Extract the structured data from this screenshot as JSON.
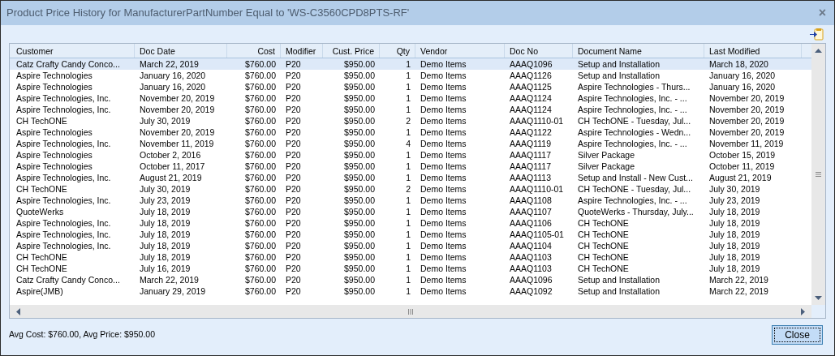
{
  "window": {
    "title": "Product Price History for ManufacturerPartNumber Equal to 'WS-C3560CPD8PTS-RF'",
    "close_label": "×"
  },
  "table": {
    "columns": [
      {
        "label": "Customer"
      },
      {
        "label": "Doc Date"
      },
      {
        "label": "Cost"
      },
      {
        "label": "Modifier"
      },
      {
        "label": "Cust. Price"
      },
      {
        "label": "Qty"
      },
      {
        "label": "Vendor"
      },
      {
        "label": "Doc No"
      },
      {
        "label": "Document Name"
      },
      {
        "label": "Last Modified"
      }
    ],
    "rows": [
      {
        "selected": true,
        "cells": [
          "Catz Crafty Candy Conco...",
          "March 22, 2019",
          "$760.00",
          "P20",
          "$950.00",
          "1",
          "Demo Items",
          "AAAQ1096",
          "Setup and Installation",
          "March 18, 2020"
        ]
      },
      {
        "selected": false,
        "cells": [
          "Aspire Technologies",
          "January 16, 2020",
          "$760.00",
          "P20",
          "$950.00",
          "1",
          "Demo Items",
          "AAAQ1126",
          "Setup and Installation",
          "January 16, 2020"
        ]
      },
      {
        "selected": false,
        "cells": [
          "Aspire Technologies",
          "January 16, 2020",
          "$760.00",
          "P20",
          "$950.00",
          "1",
          "Demo Items",
          "AAAQ1125",
          "Aspire Technologies - Thurs...",
          "January 16, 2020"
        ]
      },
      {
        "selected": false,
        "cells": [
          "Aspire Technologies, Inc.",
          "November 20, 2019",
          "$760.00",
          "P20",
          "$950.00",
          "1",
          "Demo Items",
          "AAAQ1124",
          "Aspire Technologies, Inc. - ...",
          "November 20, 2019"
        ]
      },
      {
        "selected": false,
        "cells": [
          "Aspire Technologies, Inc.",
          "November 20, 2019",
          "$760.00",
          "P20",
          "$950.00",
          "1",
          "Demo Items",
          "AAAQ1124",
          "Aspire Technologies, Inc. - ...",
          "November 20, 2019"
        ]
      },
      {
        "selected": false,
        "cells": [
          "CH TechONE",
          "July 30, 2019",
          "$760.00",
          "P20",
          "$950.00",
          "2",
          "Demo Items",
          "AAAQ1110-01",
          "CH TechONE - Tuesday, Jul...",
          "November 20, 2019"
        ]
      },
      {
        "selected": false,
        "cells": [
          "Aspire Technologies",
          "November 20, 2019",
          "$760.00",
          "P20",
          "$950.00",
          "1",
          "Demo Items",
          "AAAQ1122",
          "Aspire Technologies - Wedn...",
          "November 20, 2019"
        ]
      },
      {
        "selected": false,
        "cells": [
          "Aspire Technologies, Inc.",
          "November 11, 2019",
          "$760.00",
          "P20",
          "$950.00",
          "4",
          "Demo Items",
          "AAAQ1119",
          "Aspire Technologies, Inc. - ...",
          "November 11, 2019"
        ]
      },
      {
        "selected": false,
        "cells": [
          "Aspire Technologies",
          "October 2, 2016",
          "$760.00",
          "P20",
          "$950.00",
          "1",
          "Demo Items",
          "AAAQ1117",
          "Silver Package",
          "October 15, 2019"
        ]
      },
      {
        "selected": false,
        "cells": [
          "Aspire Technologies",
          "October 11, 2017",
          "$760.00",
          "P20",
          "$950.00",
          "1",
          "Demo Items",
          "AAAQ1117",
          "Silver Package",
          "October 11, 2019"
        ]
      },
      {
        "selected": false,
        "cells": [
          "Aspire Technologies, Inc.",
          "August 21, 2019",
          "$760.00",
          "P20",
          "$950.00",
          "1",
          "Demo Items",
          "AAAQ1113",
          "Setup and Install - New Cust...",
          "August 21, 2019"
        ]
      },
      {
        "selected": false,
        "cells": [
          "CH TechONE",
          "July 30, 2019",
          "$760.00",
          "P20",
          "$950.00",
          "2",
          "Demo Items",
          "AAAQ1110-01",
          "CH TechONE - Tuesday, Jul...",
          "July 30, 2019"
        ]
      },
      {
        "selected": false,
        "cells": [
          "Aspire Technologies, Inc.",
          "July 23, 2019",
          "$760.00",
          "P20",
          "$950.00",
          "1",
          "Demo Items",
          "AAAQ1108",
          "Aspire Technologies, Inc.  - ...",
          "July 23, 2019"
        ]
      },
      {
        "selected": false,
        "cells": [
          "QuoteWerks",
          "July 18, 2019",
          "$760.00",
          "P20",
          "$950.00",
          "1",
          "Demo Items",
          "AAAQ1107",
          "QuoteWerks - Thursday, July...",
          "July 18, 2019"
        ]
      },
      {
        "selected": false,
        "cells": [
          "Aspire Technologies, Inc.",
          "July 18, 2019",
          "$760.00",
          "P20",
          "$950.00",
          "1",
          "Demo Items",
          "AAAQ1106",
          "CH TechONE",
          "July 18, 2019"
        ]
      },
      {
        "selected": false,
        "cells": [
          "Aspire Technologies, Inc.",
          "July 18, 2019",
          "$760.00",
          "P20",
          "$950.00",
          "1",
          "Demo Items",
          "AAAQ1105-01",
          "CH TechONE",
          "July 18, 2019"
        ]
      },
      {
        "selected": false,
        "cells": [
          "Aspire Technologies, Inc.",
          "July 18, 2019",
          "$760.00",
          "P20",
          "$950.00",
          "1",
          "Demo Items",
          "AAAQ1104",
          "CH TechONE",
          "July 18, 2019"
        ]
      },
      {
        "selected": false,
        "cells": [
          "CH TechONE",
          "July 18, 2019",
          "$760.00",
          "P20",
          "$950.00",
          "1",
          "Demo Items",
          "AAAQ1103",
          "CH TechONE",
          "July 18, 2019"
        ]
      },
      {
        "selected": false,
        "cells": [
          "CH TechONE",
          "July 16, 2019",
          "$760.00",
          "P20",
          "$950.00",
          "1",
          "Demo Items",
          "AAAQ1103",
          "CH TechONE",
          "July 18, 2019"
        ]
      },
      {
        "selected": false,
        "cells": [
          "Catz Crafty Candy Conco...",
          "March 22, 2019",
          "$760.00",
          "P20",
          "$950.00",
          "1",
          "Demo Items",
          "AAAQ1096",
          "Setup and Installation",
          "March 22, 2019"
        ]
      },
      {
        "selected": false,
        "cells": [
          "Aspire(JMB)",
          "January 29, 2019",
          "$760.00",
          "P20",
          "$950.00",
          "1",
          "Demo Items",
          "AAAQ1092",
          "Setup and Installation",
          "March 22, 2019"
        ]
      }
    ]
  },
  "summary": "Avg Cost: $760.00, Avg Price: $950.00",
  "buttons": [
    {
      "label": "Close"
    }
  ]
}
